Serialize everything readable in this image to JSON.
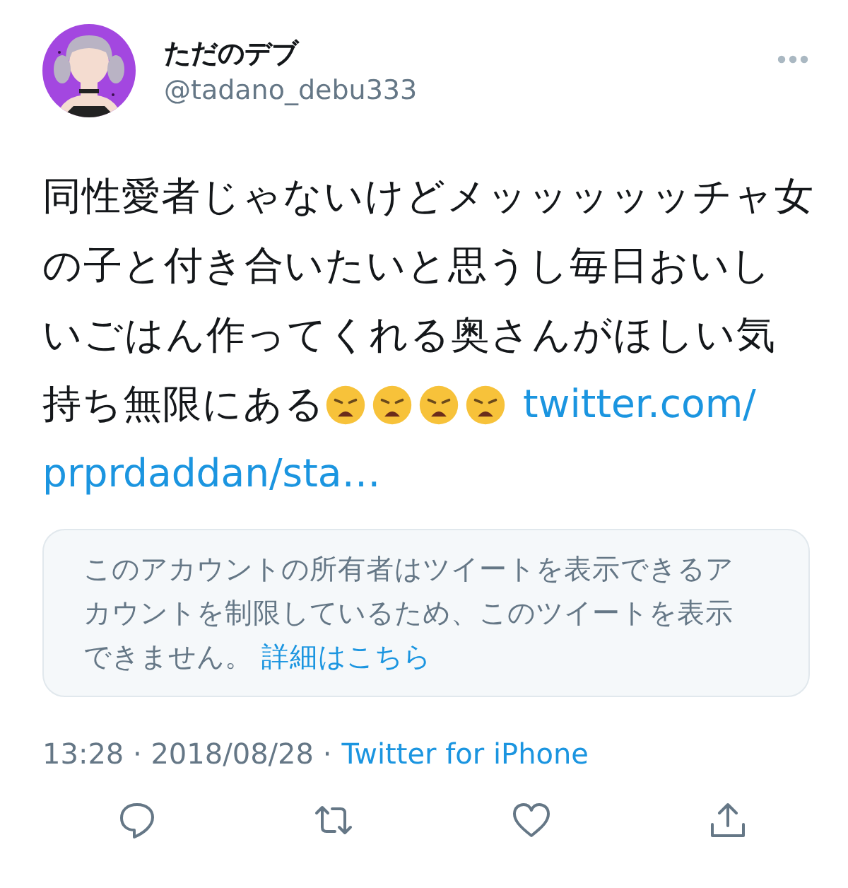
{
  "author": {
    "name": "ただのデブ",
    "handle": "@tadano_debu333"
  },
  "tweet": {
    "lines": [
      "同性愛者じゃないけどメッッッッッチャ女",
      "の子と付き合いたいと思うし毎日おいし",
      "いごはん作ってくれる奥さんがほしい気",
      "持ち無限にある"
    ],
    "link_lines": [
      "twitter.com/",
      "prprdaddan/sta…"
    ]
  },
  "notice": {
    "lines": [
      "このアカウントの所有者はツイートを表示できるア",
      "カウントを制限しているため、このツイートを表示",
      "できません。"
    ],
    "link": "詳細はこちら"
  },
  "meta": {
    "timestamp": "13:28 · 2018/08/28 ·",
    "source": "Twitter for iPhone"
  }
}
